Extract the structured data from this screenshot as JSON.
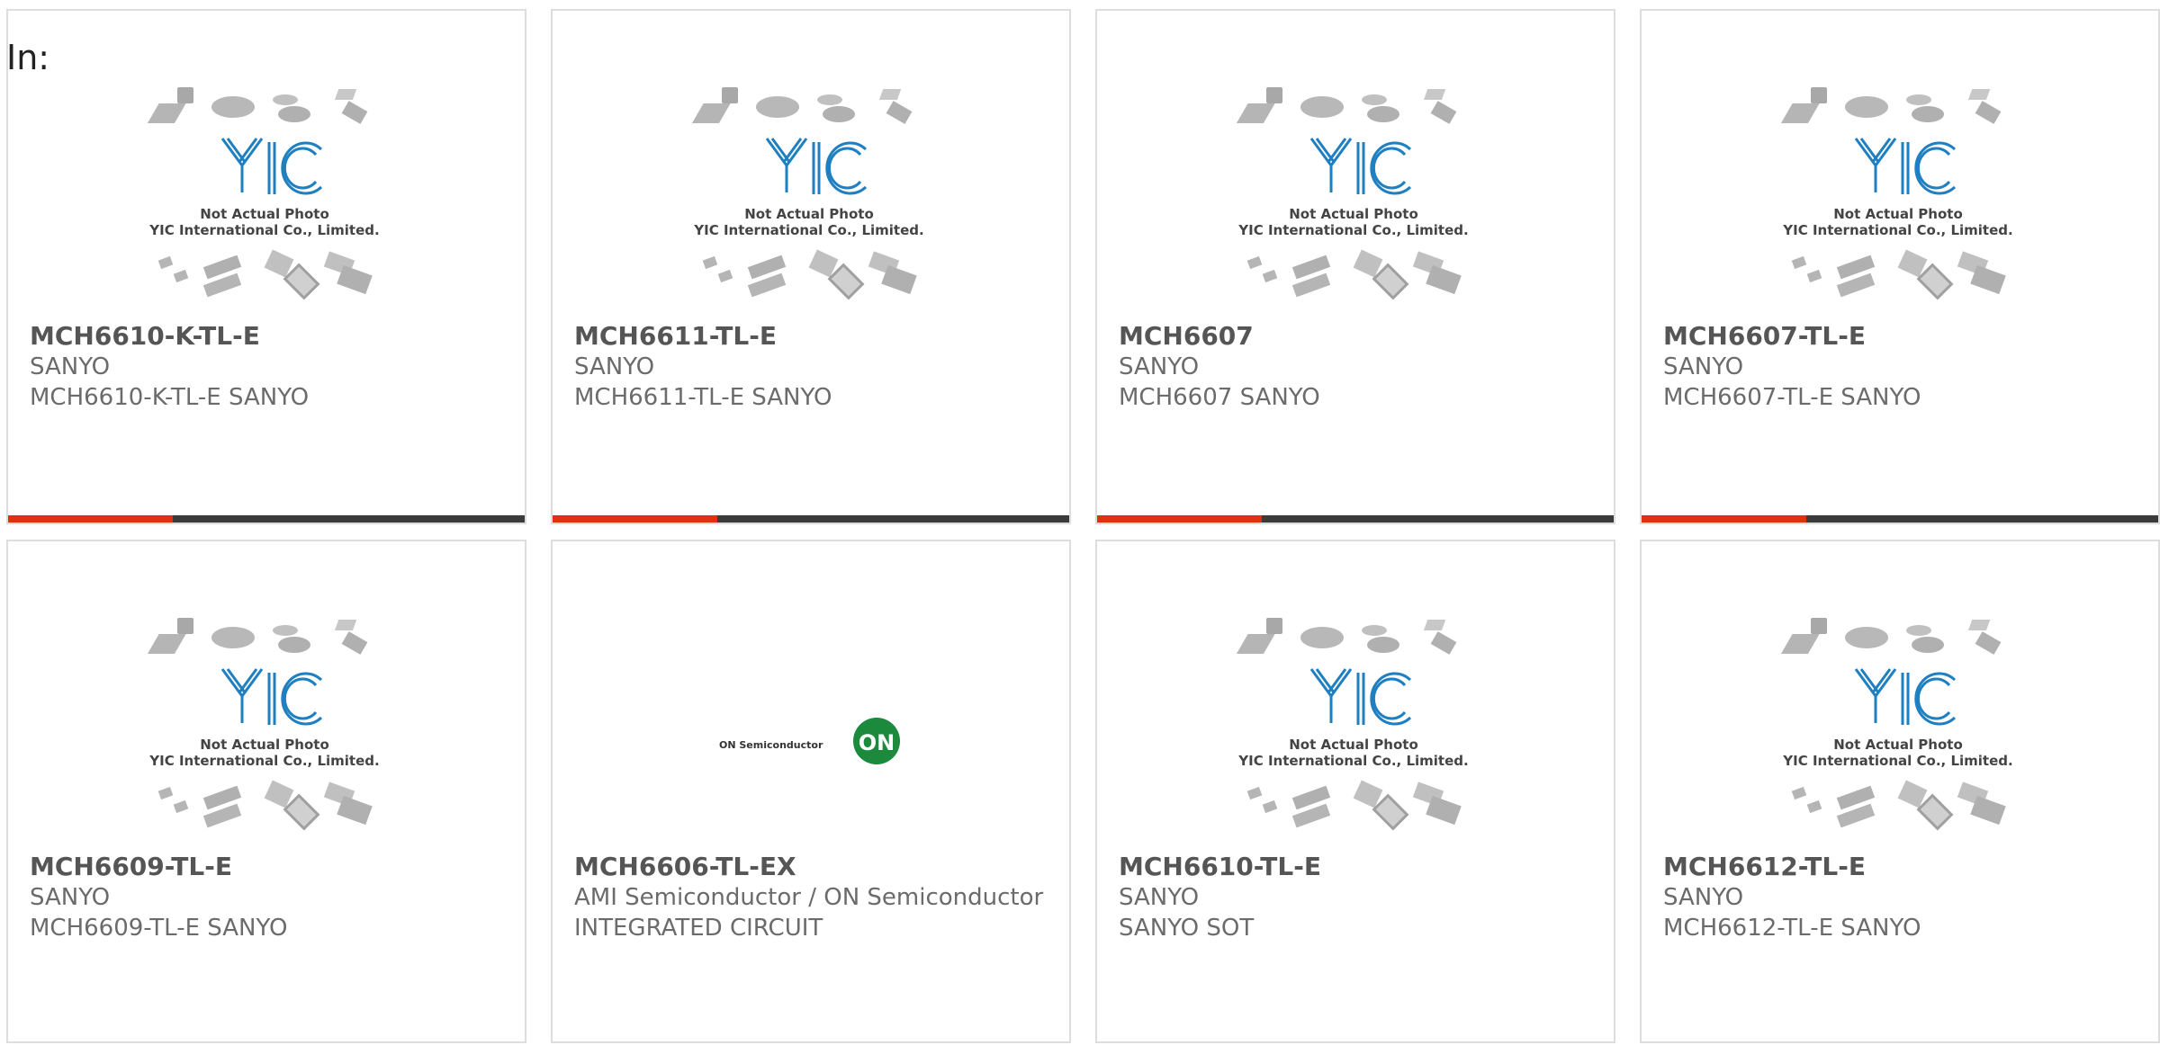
{
  "page": {
    "in_label": "In:"
  },
  "placeholder_image": {
    "caption_line1": "Not Actual Photo",
    "caption_line2": "YIC International Co., Limited.",
    "logo_text": "YIC"
  },
  "onsemi_image": {
    "brand_text": "ON Semiconductor",
    "badge_text": "ON"
  },
  "colors": {
    "accent": "#e03010",
    "bar_dark": "#3b3b3b",
    "logo_blue": "#1f7fc0",
    "onsemi_green": "#1c8a3c"
  },
  "products": [
    {
      "part": "MCH6610-K-TL-E",
      "maker": "SANYO",
      "desc": "MCH6610-K-TL-E SANYO",
      "image": "yic-placeholder"
    },
    {
      "part": "MCH6611-TL-E",
      "maker": "SANYO",
      "desc": "MCH6611-TL-E SANYO",
      "image": "yic-placeholder"
    },
    {
      "part": "MCH6607",
      "maker": "SANYO",
      "desc": "MCH6607 SANYO",
      "image": "yic-placeholder"
    },
    {
      "part": "MCH6607-TL-E",
      "maker": "SANYO",
      "desc": "MCH6607-TL-E SANYO",
      "image": "yic-placeholder"
    },
    {
      "part": "MCH6609-TL-E",
      "maker": "SANYO",
      "desc": "MCH6609-TL-E SANYO",
      "image": "yic-placeholder"
    },
    {
      "part": "MCH6606-TL-EX",
      "maker": "AMI Semiconductor / ON Semiconductor",
      "desc": "INTEGRATED CIRCUIT",
      "image": "onsemi-logo"
    },
    {
      "part": "MCH6610-TL-E",
      "maker": "SANYO",
      "desc": "SANYO SOT",
      "image": "yic-placeholder"
    },
    {
      "part": "MCH6612-TL-E",
      "maker": "SANYO",
      "desc": "MCH6612-TL-E SANYO",
      "image": "yic-placeholder"
    }
  ]
}
